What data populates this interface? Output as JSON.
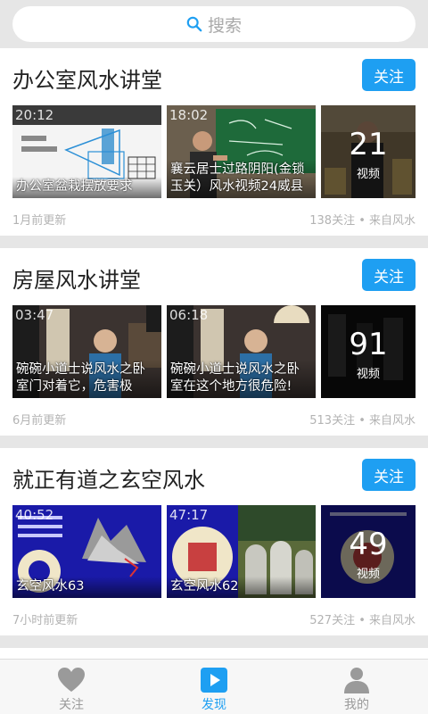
{
  "search": {
    "placeholder": "搜索"
  },
  "cards": [
    {
      "title": "办公室风水讲堂",
      "follow": "关注",
      "videos": [
        {
          "duration": "20:12",
          "caption": "办公室盆栽摆放要求"
        },
        {
          "duration": "18:02",
          "caption": "襄云居士过路阴阳(金锁玉关）风水视频24威县"
        }
      ],
      "more_count": "21",
      "more_label": "视频",
      "updated": "1月前更新",
      "stats": "138关注 • 来自风水"
    },
    {
      "title": "房屋风水讲堂",
      "follow": "关注",
      "videos": [
        {
          "duration": "03:47",
          "caption": "碗碗小道士说风水之卧室门对着它，危害极"
        },
        {
          "duration": "06:18",
          "caption": "碗碗小道士说风水之卧室在这个地方很危险!"
        }
      ],
      "more_count": "91",
      "more_label": "视频",
      "updated": "6月前更新",
      "stats": "513关注 • 来自风水"
    },
    {
      "title": "就正有道之玄空风水",
      "follow": "关注",
      "videos": [
        {
          "duration": "40:52",
          "caption": "玄空风水63"
        },
        {
          "duration": "47:17",
          "caption": "玄空风水62"
        }
      ],
      "more_count": "49",
      "more_label": "视频",
      "updated": "7小时前更新",
      "stats": "527关注 • 来自风水"
    }
  ],
  "tabbar": [
    {
      "label": "关注",
      "icon": "heart-icon"
    },
    {
      "label": "发现",
      "icon": "play-icon"
    },
    {
      "label": "我的",
      "icon": "person-icon"
    }
  ],
  "colors": {
    "accent": "#1e9ff2",
    "muted": "#b3b3b3",
    "background": "#e6e6e6"
  }
}
